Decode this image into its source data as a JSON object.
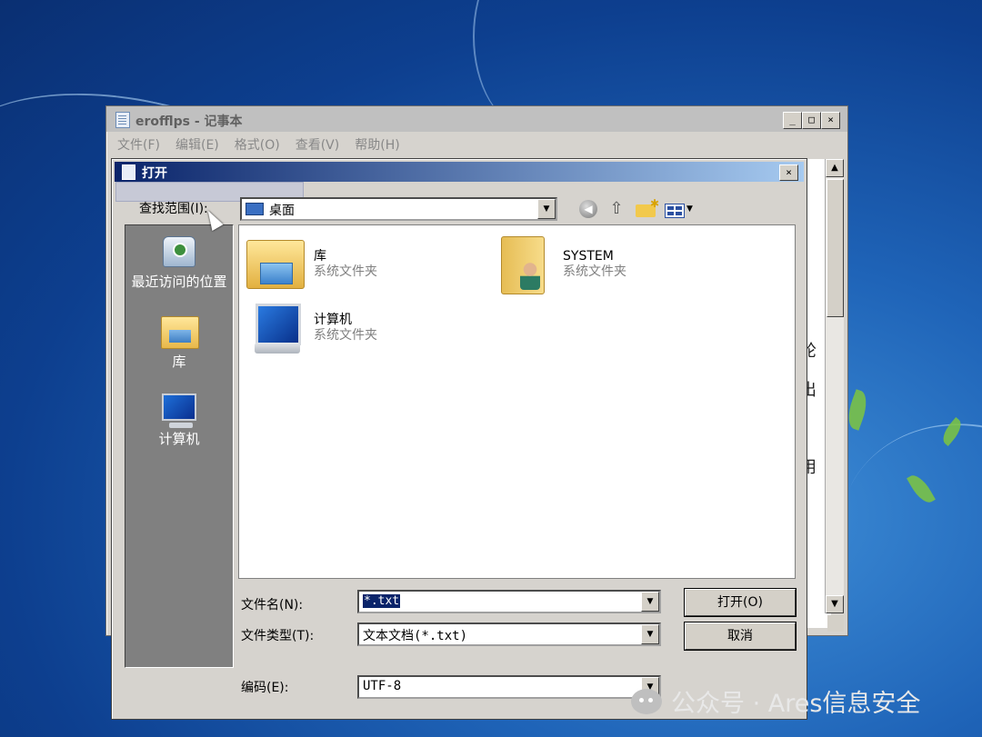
{
  "notepad": {
    "title": "erofflps - 记事本",
    "menu": [
      "文件(F)",
      "编辑(E)",
      "格式(O)",
      "查看(V)",
      "帮助(H)"
    ],
    "window_buttons": [
      "_",
      "□",
      "×"
    ],
    "visible_chars": [
      "轮",
      "出",
      "用"
    ]
  },
  "dialog": {
    "title": "打开",
    "close": "×",
    "look_in_label": "查找范围(I):",
    "look_in_value": "桌面",
    "toolbar_icons": [
      "back-icon",
      "up-folder-icon",
      "new-folder-icon",
      "views-menu-icon"
    ],
    "places": [
      {
        "label": "最近访问的位置",
        "icon": "recent-places-icon"
      },
      {
        "label": "库",
        "icon": "library-icon"
      },
      {
        "label": "计算机",
        "icon": "computer-icon"
      }
    ],
    "files": [
      {
        "name": "库",
        "type": "系统文件夹",
        "icon": "library-folder-icon"
      },
      {
        "name": "SYSTEM",
        "type": "系统文件夹",
        "icon": "user-folder-icon"
      },
      {
        "name": "计算机",
        "type": "系统文件夹",
        "icon": "computer-icon"
      }
    ],
    "filename_label": "文件名(N):",
    "filename_value": "*.txt",
    "filetype_label": "文件类型(T):",
    "filetype_value": "文本文档(*.txt)",
    "encoding_label": "编码(E):",
    "encoding_value": "UTF-8",
    "open_button": "打开(O)",
    "cancel_button": "取消"
  },
  "watermark": "公众号 · Ares信息安全",
  "colors": {
    "dialog_title_start": "#0a246a",
    "dialog_title_end": "#a6caf0",
    "desktop": "#1f64b8"
  }
}
